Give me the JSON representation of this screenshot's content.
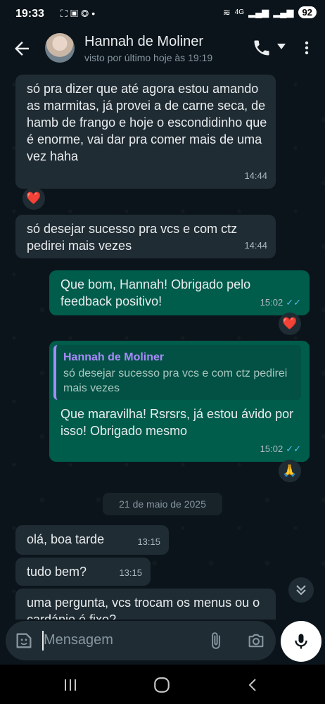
{
  "status_bar": {
    "time": "19:33",
    "left_icons": [
      "screenshot-icon",
      "cast-icon",
      "instagram-icon",
      "dot-icon"
    ],
    "network": "4G",
    "battery": "92"
  },
  "header": {
    "contact_name": "Hannah de Moliner",
    "last_seen": "visto por último hoje às 19:19"
  },
  "messages": [
    {
      "direction": "in",
      "text": "só pra dizer que até agora estou amando as marmitas, já provei a de carne seca, de hamb de frango e hoje o escondidinho que é enorme, vai dar pra comer mais de uma vez haha",
      "time": "14:44",
      "reaction": "❤️"
    },
    {
      "direction": "in",
      "text": "só desejar sucesso pra vcs e com ctz pedirei mais vezes",
      "time": "14:44"
    },
    {
      "direction": "out",
      "text": "Que bom, Hannah! Obrigado pelo feedback positivo!",
      "time": "15:02",
      "ticks": "✓✓",
      "reaction": "❤️"
    },
    {
      "direction": "out",
      "quote_name": "Hannah de Moliner",
      "quote_text": "só desejar sucesso pra vcs e com ctz pedirei mais vezes",
      "text": "Que maravilha! Rsrsrs, já estou ávido por isso! Obrigado mesmo",
      "time": "15:02",
      "ticks": "✓✓",
      "reaction": "🙏"
    },
    {
      "direction": "in",
      "text": "olá, boa tarde",
      "time": "13:15"
    },
    {
      "direction": "in",
      "text": "tudo bem?",
      "time": "13:15"
    },
    {
      "direction": "in",
      "text": "uma pergunta, vcs trocam os menus ou o cardápio é fixo?"
    }
  ],
  "date_divider": "21 de maio de 2025",
  "input": {
    "placeholder": "Mensagem"
  },
  "colors": {
    "background": "#0b141a",
    "incoming_bubble": "#202c33",
    "outgoing_bubble": "#005c4b",
    "read_ticks": "#53bdeb",
    "quote_accent": "#a78bfa"
  }
}
